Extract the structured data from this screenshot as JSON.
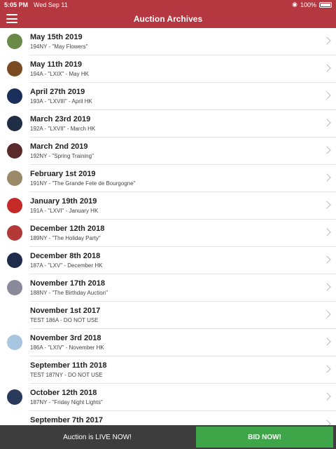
{
  "status_bar": {
    "time": "5:05 PM",
    "date": "Wed Sep 11",
    "battery": "100%"
  },
  "header": {
    "title": "Auction Archives"
  },
  "auctions": [
    {
      "date": "May 15th 2019",
      "subtitle": "194NY - \"May Flowers\"",
      "thumb": "#6b8a4a"
    },
    {
      "date": "May 11th 2019",
      "subtitle": "194A - \"LXIX\" - May HK",
      "thumb": "#7a4a22"
    },
    {
      "date": "April 27th 2019",
      "subtitle": "193A - \"LXVIII\" - April HK",
      "thumb": "#1c2f5a"
    },
    {
      "date": "March 23rd 2019",
      "subtitle": "192A - \"LXVII\" - March HK",
      "thumb": "#1f2d45"
    },
    {
      "date": "March 2nd 2019",
      "subtitle": "192NY - \"Spring Training\"",
      "thumb": "#5a2a2a"
    },
    {
      "date": "February 1st 2019",
      "subtitle": "191NY - \"The Grande Fete de Bourgogne\"",
      "thumb": "#9a8a6a"
    },
    {
      "date": "January 19th 2019",
      "subtitle": "191A - \"LXVI\" - January HK",
      "thumb": "#c42a28"
    },
    {
      "date": "December 12th 2018",
      "subtitle": "189NY - \"The Holiday Party\"",
      "thumb": "#b33838"
    },
    {
      "date": "December 8th 2018",
      "subtitle": "187A - \"LXV\" - December HK",
      "thumb": "#1e2b4a"
    },
    {
      "date": "November 17th 2018",
      "subtitle": "188NY - \"The Birthday Auction\"",
      "thumb": "#8a8a9a"
    },
    {
      "date": "November 1st 2017",
      "subtitle": "TEST 186A - DO NOT USE",
      "thumb": ""
    },
    {
      "date": "November 3rd 2018",
      "subtitle": "186A - \"LXIV\" - November HK",
      "thumb": "#a9c6e0"
    },
    {
      "date": "September 11th 2018",
      "subtitle": "TEST 187NY - DO NOT USE",
      "thumb": ""
    },
    {
      "date": "October 12th 2018",
      "subtitle": "187NY - \"Friday Night Lights\"",
      "thumb": "#2a3a5a"
    },
    {
      "date": "September 7th 2017",
      "subtitle": "",
      "thumb": ""
    }
  ],
  "footer": {
    "live_text": "Auction is LIVE NOW!",
    "bid_label": "BID NOW!"
  }
}
